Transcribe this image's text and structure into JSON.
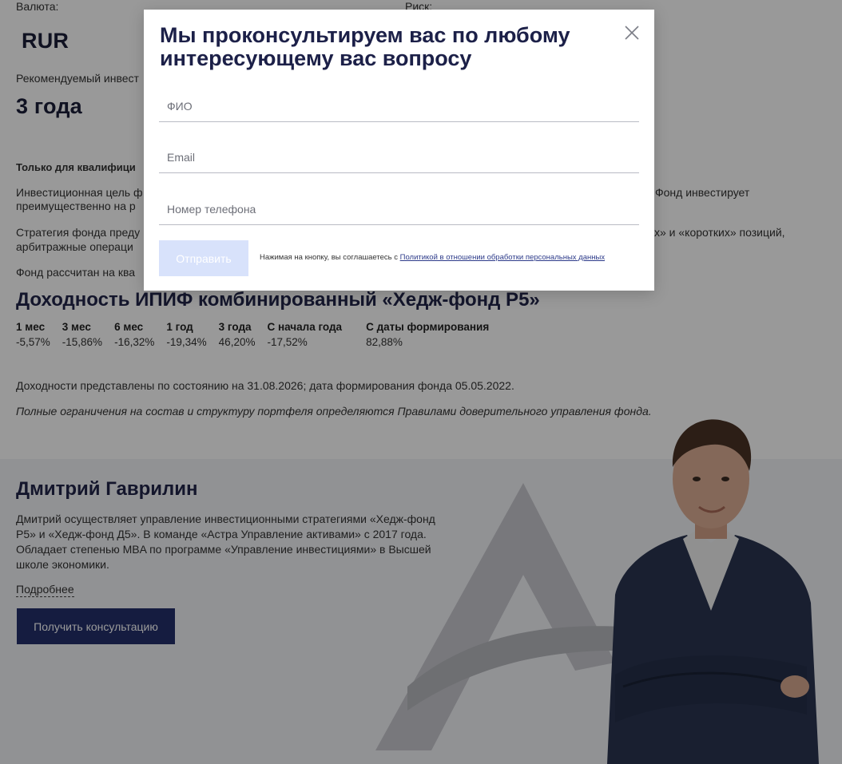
{
  "fund": {
    "currency_label": "Валюта:",
    "currency_value": "RUR",
    "risk_label": "Риск:",
    "horizon_label": "Рекомендуемый инвест",
    "horizon_value": "3 года",
    "qualified_note": "Только для квалифици",
    "goal_text_left_1": "Инвестиционная цель ф",
    "goal_text_left_2": "преимущественно на р",
    "goal_text_right_1": "Фонд инвестирует",
    "strategy_text_left_1": "Стратегия фонда преду",
    "strategy_text_left_2": "арбитражные операци",
    "strategy_text_right_1": "х» и «коротких» позиций,",
    "designed_text_left": "Фонд рассчитан на ква"
  },
  "returns": {
    "title": "Доходность ИПИФ комбинированный «Хедж-фонд Р5»",
    "headers": [
      "1 мес",
      "3 мес",
      "6 мес",
      "1 год",
      "3 года",
      "С начала года",
      "С даты формирования"
    ],
    "values": [
      "-5,57%",
      "-15,86%",
      "-16,32%",
      "-19,34%",
      "46,20%",
      "-17,52%",
      "82,88%"
    ],
    "note": "Доходности представлены по состоянию на 31.08.2026; дата формирования фонда 05.05.2022.",
    "disclaimer": "Полные ограничения на состав и структуру портфеля определяются Правилами доверительного управления фонда."
  },
  "manager": {
    "name": "Дмитрий Гаврилин",
    "bio": "Дмитрий осуществляет управление инвестиционными стратегиями «Хедж-фонд Р5» и «Хедж-фонд Д5». В команде «Астра Управление активами» с 2017 года. Обладает степенью MBA по программе «Управление инвестициями» в Высшей школе экономики.",
    "more_link": "Подробнее",
    "cta": "Получить консультацию"
  },
  "modal": {
    "title": "Мы проконсультируем вас по любому интересующему вас вопросу",
    "fio_placeholder": "ФИО",
    "email_placeholder": "Email",
    "phone_placeholder": "Номер телефона",
    "submit": "Отправить",
    "consent_text": "Нажимая на кнопку, вы соглашаетесь с ",
    "consent_link": "Политикой в отношении обработки персональных данных"
  },
  "colors": {
    "brand_dark": "#1c2048",
    "button_primary": "#23306b",
    "button_disabled": "#d8e2fb"
  }
}
